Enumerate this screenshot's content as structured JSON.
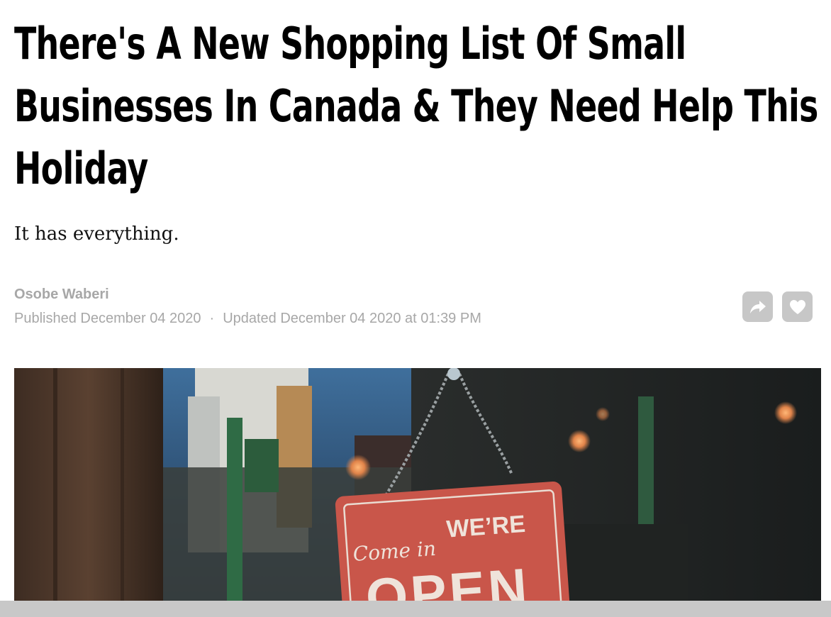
{
  "article": {
    "headline": "There's A New Shopping List Of Small Businesses In Canada & They Need Help This Holiday",
    "subheadline": "It has everything.",
    "author": "Osobe Waberi",
    "published": "Published December 04 2020",
    "separator": "·",
    "updated": "Updated December 04 2020 at 01:39 PM"
  },
  "actions": {
    "share_icon": "share-arrow-icon",
    "like_icon": "heart-icon"
  },
  "hero_image": {
    "sign_script": "Come in",
    "sign_top": "WE’RE",
    "sign_bottom": "OPEN"
  },
  "colors": {
    "meta_text": "#a7a7a7",
    "button_bg": "#c7c7c7",
    "sign_red": "#c9564a"
  }
}
